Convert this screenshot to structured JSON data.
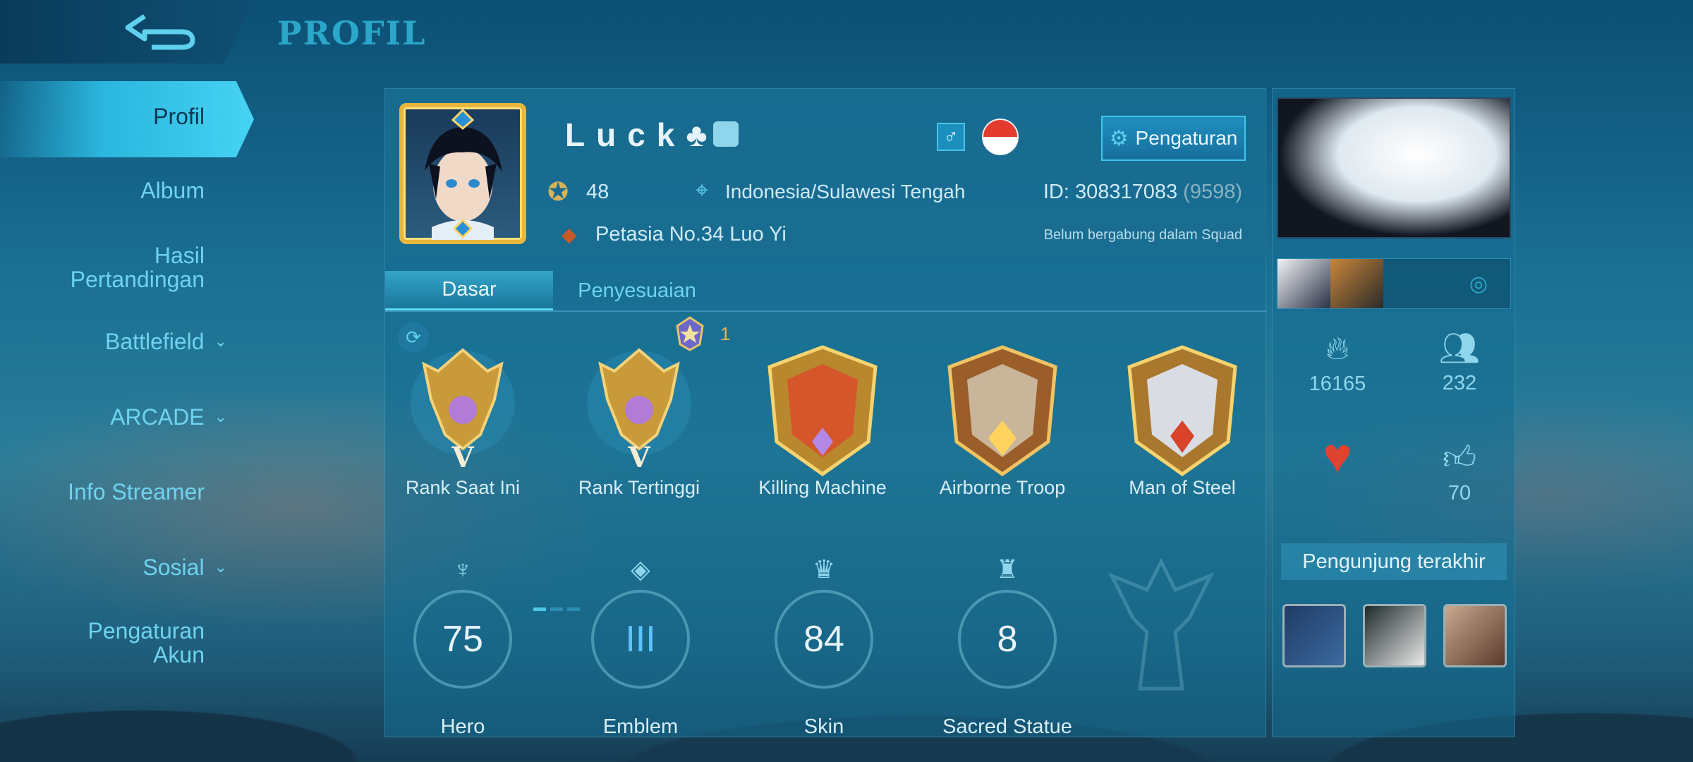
{
  "header": {
    "title": "PROFIL"
  },
  "sidebar": {
    "items": [
      {
        "label": "Profil",
        "active": true
      },
      {
        "label": "Album"
      },
      {
        "label": "Hasil\nPertandingan"
      },
      {
        "label": "Battlefield",
        "has_dropdown": true
      },
      {
        "label": "ARCADE",
        "has_dropdown": true
      },
      {
        "label": "Info Streamer"
      },
      {
        "label": "Sosial",
        "has_dropdown": true
      },
      {
        "label": "Pengaturan\nAkun"
      }
    ]
  },
  "profile": {
    "name": "Luck♣",
    "level": "48",
    "location": "Indonesia/Sulawesi Tengah",
    "id_label": "ID: 308317083",
    "id_server": "(9598)",
    "pet": "Petasia No.34 Luo Yi",
    "squad_status": "Belum bergabung dalam Squad",
    "settings_label": "Pengaturan",
    "gender_symbol": "♂"
  },
  "tabs": [
    {
      "label": "Dasar",
      "active": true
    },
    {
      "label": "Penyesuaian"
    }
  ],
  "star_count": "1",
  "badges": [
    {
      "label": "Rank Saat Ini",
      "tier": "V",
      "icon": "mythic-rank-icon"
    },
    {
      "label": "Rank Tertinggi",
      "tier": "V",
      "icon": "mythic-rank-icon"
    },
    {
      "label": "Killing Machine",
      "icon": "killing-machine-badge"
    },
    {
      "label": "Airborne Troop",
      "icon": "airborne-troop-badge"
    },
    {
      "label": "Man of Steel",
      "icon": "man-of-steel-badge"
    }
  ],
  "stats": [
    {
      "label": "Hero",
      "value": "75"
    },
    {
      "label": "Emblem",
      "value": "III"
    },
    {
      "label": "Skin",
      "value": "84"
    },
    {
      "label": "Sacred Statue",
      "value": "8"
    }
  ],
  "right": {
    "popularity": "16165",
    "followers": "232",
    "likes": "70",
    "visitors_title": "Pengunjung terakhir"
  },
  "colors": {
    "accent": "#2ab6de",
    "title": "#2aa7c9",
    "text": "#cfeaf5",
    "gold": "#e7b63d"
  }
}
